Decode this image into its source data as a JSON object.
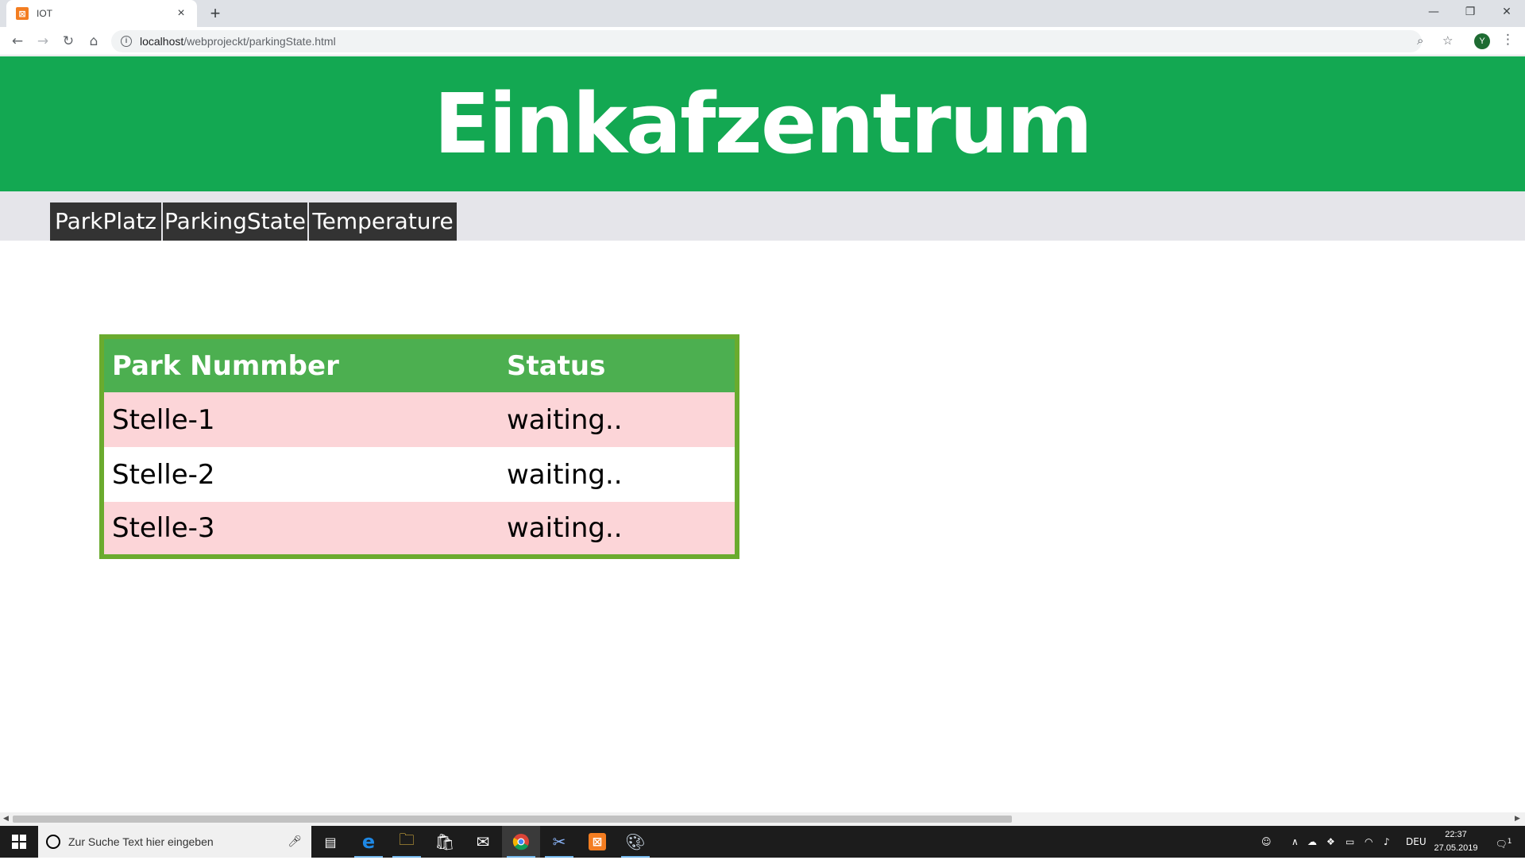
{
  "browser": {
    "tab_title": "IOT",
    "tab_favicon": "⊠",
    "tab_close": "×",
    "new_tab": "+",
    "url_host": "localhost",
    "url_path": "/webprojeckt/parkingState.html",
    "profile_initial": "Y"
  },
  "page": {
    "site_title": "Einkafzentrum",
    "nav": [
      {
        "label": "ParkPlatz"
      },
      {
        "label": "ParkingState"
      },
      {
        "label": "Temperature"
      }
    ],
    "table": {
      "headers": [
        "Park Nummber",
        "Status"
      ],
      "rows": [
        {
          "park": "Stelle-1",
          "status": "waiting.."
        },
        {
          "park": "Stelle-2",
          "status": "waiting.."
        },
        {
          "park": "Stelle-3",
          "status": "waiting.."
        }
      ]
    }
  },
  "taskbar": {
    "search_placeholder": "Zur Suche Text hier eingeben",
    "language": "DEU",
    "time": "22:37",
    "date": "27.05.2019",
    "notification_count": "1"
  },
  "colors": {
    "header_green": "#13a852",
    "table_header_green": "#4caf50",
    "table_border": "#6aab2e",
    "row_pink": "#fcd5d8",
    "nav_dark": "#333333"
  }
}
